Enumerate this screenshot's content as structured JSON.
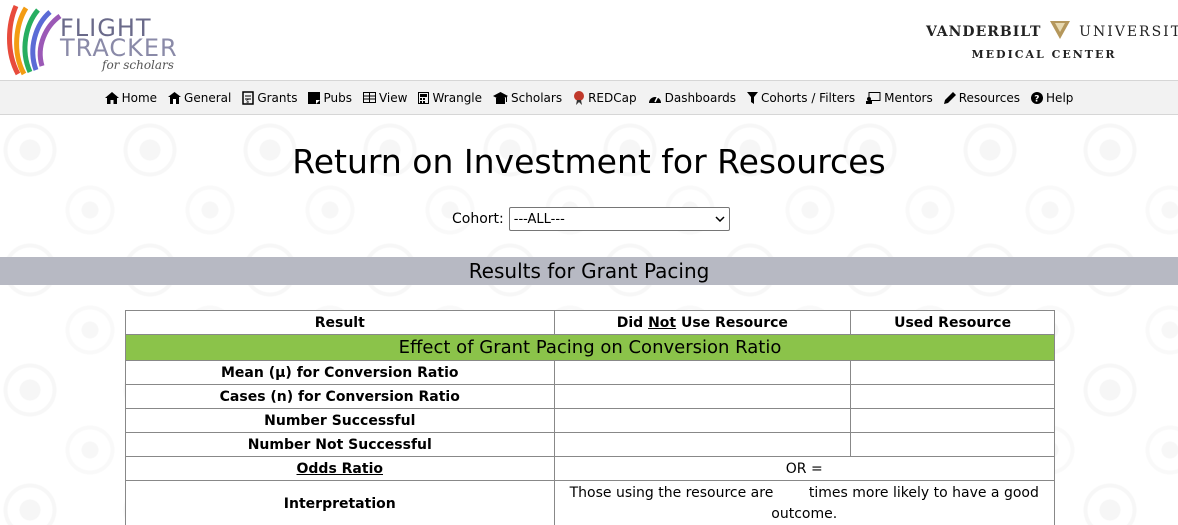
{
  "logo": {
    "line1": "FLIGHT",
    "line2": "TRACKER",
    "subtitle": "for scholars"
  },
  "institution": {
    "part1": "VANDERBILT",
    "part2": "UNIVERSITY",
    "line2": "MEDICAL CENTER"
  },
  "nav": [
    {
      "label": "Home",
      "icon": "home-icon"
    },
    {
      "label": "General",
      "icon": "general-icon"
    },
    {
      "label": "Grants",
      "icon": "grants-icon"
    },
    {
      "label": "Pubs",
      "icon": "pubs-icon"
    },
    {
      "label": "View",
      "icon": "view-icon"
    },
    {
      "label": "Wrangle",
      "icon": "wrangle-icon"
    },
    {
      "label": "Scholars",
      "icon": "scholars-icon"
    },
    {
      "label": "REDCap",
      "icon": "redcap-icon"
    },
    {
      "label": "Dashboards",
      "icon": "dashboards-icon"
    },
    {
      "label": "Cohorts / Filters",
      "icon": "filter-icon"
    },
    {
      "label": "Mentors",
      "icon": "mentors-icon"
    },
    {
      "label": "Resources",
      "icon": "pencil-icon"
    },
    {
      "label": "Help",
      "icon": "help-icon"
    }
  ],
  "page": {
    "title": "Return on Investment for Resources"
  },
  "cohort": {
    "label": "Cohort:",
    "selected": "---ALL---"
  },
  "section": {
    "title": "Results for Grant Pacing"
  },
  "table": {
    "headers": {
      "result": "Result",
      "not_used_pre": "Did ",
      "not_used_not": "Not",
      "not_used_post": " Use Resource",
      "used": "Used Resource"
    },
    "group_title": "Effect of Grant Pacing on Conversion Ratio",
    "rows": [
      "Mean (μ) for Conversion Ratio",
      "Cases (n) for Conversion Ratio",
      "Number Successful",
      "Number Not Successful"
    ],
    "odds_label": "Odds Ratio",
    "odds_value": "OR =",
    "interp_label": "Interpretation",
    "interp_text": "Those using the resource are        times more likely to have a good outcome."
  }
}
